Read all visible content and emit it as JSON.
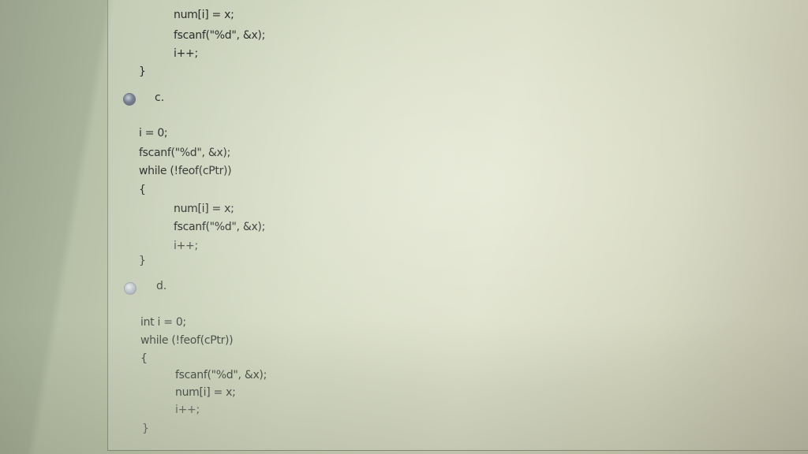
{
  "option_b_tail": {
    "lines": [
      "num[i] = x;",
      "fscanf(\"%d\", &x);",
      "i++;"
    ],
    "close": "}"
  },
  "option_c": {
    "label": "c.",
    "lines": [
      "i = 0;",
      "fscanf(\"%d\", &x);",
      "while (!feof(cPtr))",
      "{"
    ],
    "inner": [
      "num[i] = x;",
      "fscanf(\"%d\", &x);",
      "i++;"
    ],
    "close": "}"
  },
  "option_d": {
    "label": "d.",
    "lines": [
      "int i = 0;",
      "while (!feof(cPtr))",
      "{"
    ],
    "inner": [
      "fscanf(\"%d\", &x);",
      "num[i] = x;",
      "i++;"
    ],
    "close": "}"
  }
}
